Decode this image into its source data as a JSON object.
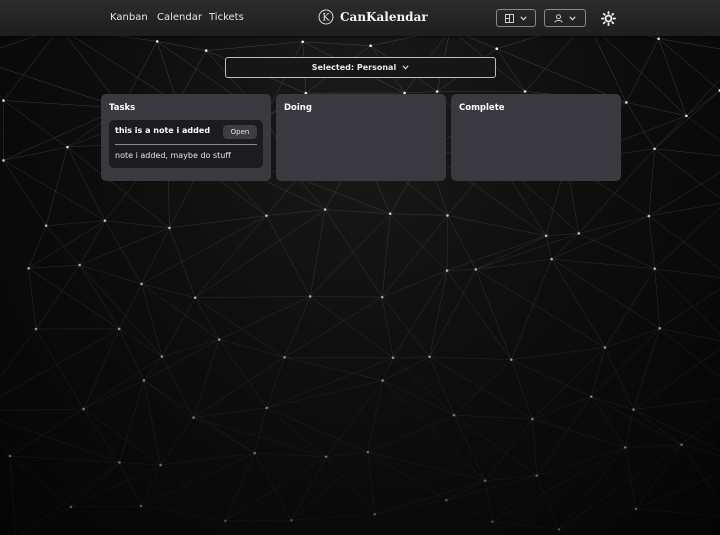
{
  "nav": {
    "links": [
      "Kanban",
      "Calendar",
      "Tickets"
    ],
    "brand_logo_letter": "K",
    "brand_name": "CanKalendar",
    "board_icon": "board-icon",
    "user_icon": "user-icon",
    "theme_icon": "sun-icon"
  },
  "selector": {
    "label": "Selected: Personal"
  },
  "columns": [
    {
      "title": "Tasks",
      "cards": [
        {
          "title": "this is a note i added",
          "action": "Open",
          "body": "note i added, maybe do stuff"
        }
      ]
    },
    {
      "title": "Doing",
      "cards": []
    },
    {
      "title": "Complete",
      "cards": []
    }
  ],
  "colors": {
    "column_bg": "#3a393f",
    "card_bg": "#1c1b20",
    "navbar_bg": "#262626"
  }
}
